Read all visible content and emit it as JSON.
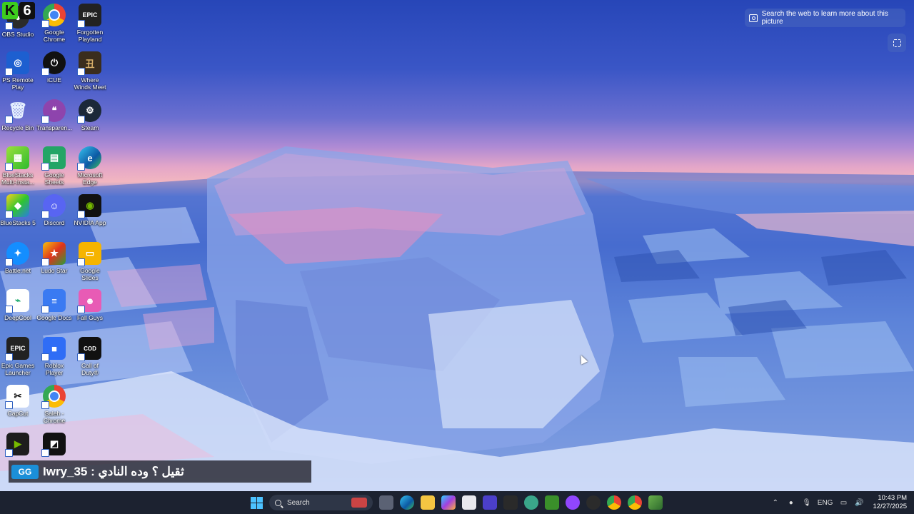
{
  "badge": {
    "letter": "K",
    "number": "6"
  },
  "desktop_icons": [
    {
      "label": "OBS Studio",
      "icon": "obs-icon"
    },
    {
      "label": "Google Chrome",
      "icon": "chrome-icon"
    },
    {
      "label": "Forgotten Playland",
      "icon": "epic-games-icon",
      "glyph": "EPIC"
    },
    {
      "label": "PS Remote Play",
      "icon": "ps-remote-play-icon"
    },
    {
      "label": "iCUE",
      "icon": "icue-icon"
    },
    {
      "label": "Where Winds Meet",
      "icon": "where-winds-meet-icon"
    },
    {
      "label": "Recycle Bin",
      "icon": "recycle-bin-icon"
    },
    {
      "label": "Transparen...",
      "icon": "transparent-app-icon"
    },
    {
      "label": "Steam",
      "icon": "steam-icon"
    },
    {
      "label": "BlueStacks Multi-Insta...",
      "icon": "bluestacks-multi-icon"
    },
    {
      "label": "Google Sheets",
      "icon": "google-sheets-icon"
    },
    {
      "label": "Microsoft Edge",
      "icon": "edge-icon"
    },
    {
      "label": "BlueStacks 5",
      "icon": "bluestacks-icon"
    },
    {
      "label": "Discord",
      "icon": "discord-icon"
    },
    {
      "label": "NVIDIA App",
      "icon": "nvidia-icon"
    },
    {
      "label": "Battle.net",
      "icon": "battlenet-icon"
    },
    {
      "label": "Ludo Star",
      "icon": "ludo-star-icon"
    },
    {
      "label": "Google Slides",
      "icon": "google-slides-icon"
    },
    {
      "label": "DeepCool",
      "icon": "deepcool-icon"
    },
    {
      "label": "Google Docs",
      "icon": "google-docs-icon"
    },
    {
      "label": "Fall Guys",
      "icon": "fall-guys-icon"
    },
    {
      "label": "Epic Games Launcher",
      "icon": "epic-launcher-icon",
      "glyph": "EPIC"
    },
    {
      "label": "Roblox Player",
      "icon": "roblox-icon"
    },
    {
      "label": "Call of Duty®",
      "icon": "call-of-duty-icon"
    },
    {
      "label": "CapCut",
      "icon": "capcut-icon"
    },
    {
      "label": "Saleh - Chrome",
      "icon": "chrome-profile-icon"
    },
    {
      "label": "",
      "icon": "nvidia-broadcast-icon"
    },
    {
      "label": "",
      "icon": "roblox-studio-icon"
    }
  ],
  "spotlight": {
    "text": "Search the web to learn more about this picture"
  },
  "chat": {
    "logo": "GG",
    "message": "Iwry_35 : ثقيل ؟ وده النادي"
  },
  "taskbar": {
    "search_placeholder": "Search",
    "apps": [
      "task-view-icon",
      "edge-icon",
      "file-explorer-icon",
      "copilot-icon",
      "store-icon",
      "media-icon",
      "epic-games-icon",
      "ai-app-icon",
      "minecraft-icon",
      "twitch-icon",
      "obs-icon",
      "chrome-icon",
      "chrome-profile-icon",
      "minecraft-block-icon"
    ],
    "tray": {
      "language": "ENG",
      "time": "10:43 PM",
      "date": "12/27/2025"
    }
  },
  "colors": {
    "taskbar_bg": "#1c2230",
    "accent": "#4cc2ff",
    "chat_bg": "#2d2d37"
  }
}
